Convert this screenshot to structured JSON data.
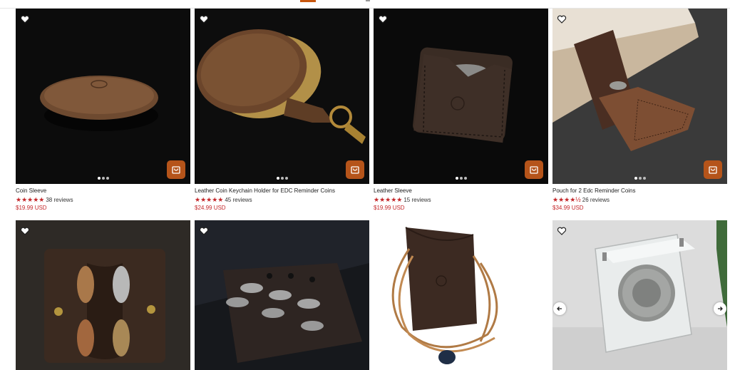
{
  "products": [
    {
      "title": "Coin Sleeve",
      "stars": "★★★★★",
      "reviews": "38 reviews",
      "price": "$19.99 USD"
    },
    {
      "title": "Leather Coin Keychain Holder for EDC Reminder Coins",
      "stars": "★★★★★",
      "reviews": "45 reviews",
      "price": "$24.99 USD"
    },
    {
      "title": "Leather Sleeve",
      "stars": "★★★★★",
      "reviews": "15 reviews",
      "price": "$19.99 USD"
    },
    {
      "title": "Pouch for 2 Edc Reminder Coins",
      "stars": "★★★★½",
      "reviews": "26 reviews",
      "price": "$34.99 USD"
    }
  ],
  "icons": {
    "wishlist": "heart-icon",
    "cart": "shopping-bag-icon",
    "prev": "arrow-left-icon",
    "next": "arrow-right-icon"
  },
  "colors": {
    "accent": "#b5541a",
    "price": "#c4282b",
    "stars": "#c4282b"
  }
}
